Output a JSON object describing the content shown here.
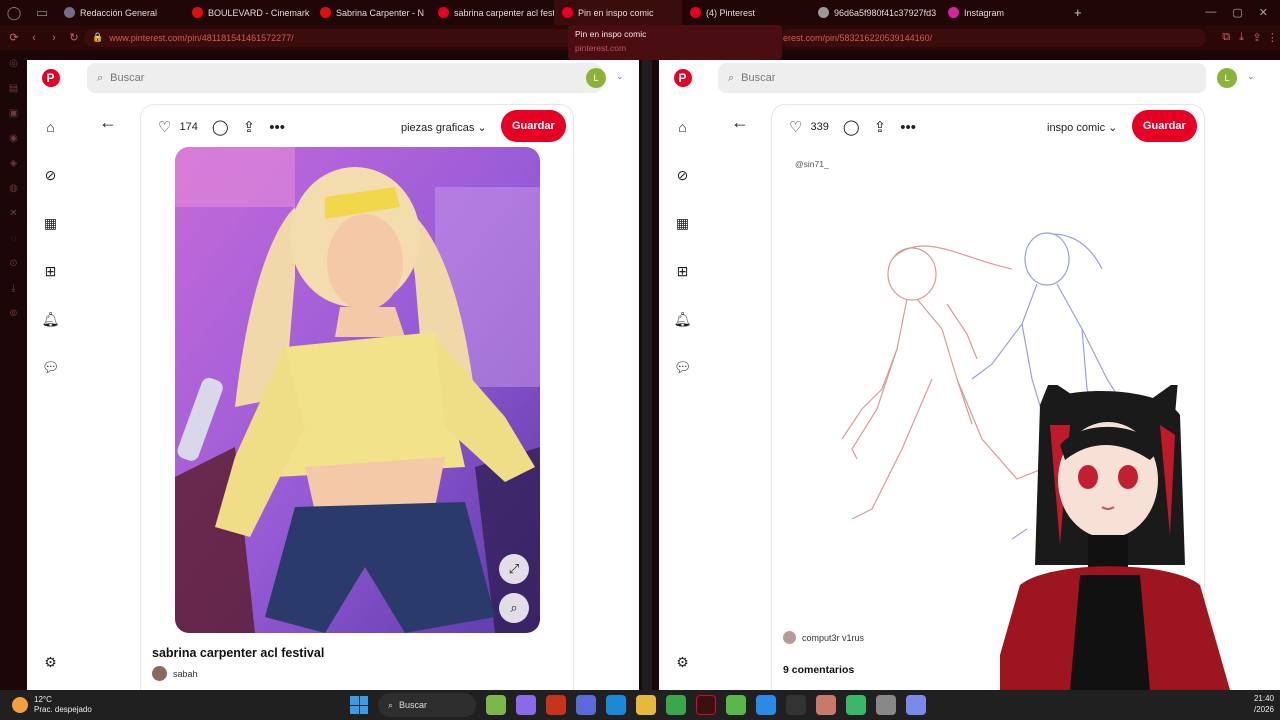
{
  "browser": {
    "tabs": [
      {
        "label": "Redacción General",
        "color": "#7a6a8a"
      },
      {
        "label": "BOULEVARD - Cinemark",
        "color": "#e01010"
      },
      {
        "label": "Sabrina Carpenter - N",
        "color": "#e01010"
      },
      {
        "label": "sabrina carpenter acl festi",
        "color": "#e60023"
      },
      {
        "label": "Pin en inspo comic",
        "color": "#e60023"
      },
      {
        "label": "(4) Pinterest",
        "color": "#e60023"
      },
      {
        "label": "96d6a5f980f41c37927fd3",
        "color": "#999999"
      },
      {
        "label": "Instagram",
        "color": "#d6249f"
      }
    ],
    "new_tab_icon": "plus-icon",
    "tooltip": {
      "title": "Pin en inspo comic",
      "domain": "pinterest.com"
    },
    "left_url": "www.pinterest.com/pin/481181541461572277/",
    "right_url": "erest.com/pin/583216220539144160/"
  },
  "left_pane": {
    "search_placeholder": "Buscar",
    "avatar_letter": "L",
    "likes": "174",
    "board": "piezas graficas",
    "save_label": "Guardar",
    "pin_title": "sabrina carpenter acl festival",
    "author": "sabah"
  },
  "right_pane": {
    "search_placeholder": "Buscar",
    "avatar_letter": "L",
    "likes": "339",
    "board": "inspo comic",
    "save_label": "Guardar",
    "watermark": "@sin71_",
    "author": "comput3r v1rus",
    "comments": "9 comentarios"
  },
  "taskbar": {
    "temperature": "12°C",
    "weather": "Prac. despejado",
    "search_label": "Buscar",
    "time": "21:40",
    "date": "/2026"
  },
  "colors": {
    "accent": "#e60023",
    "browser_bg": "#200606"
  }
}
